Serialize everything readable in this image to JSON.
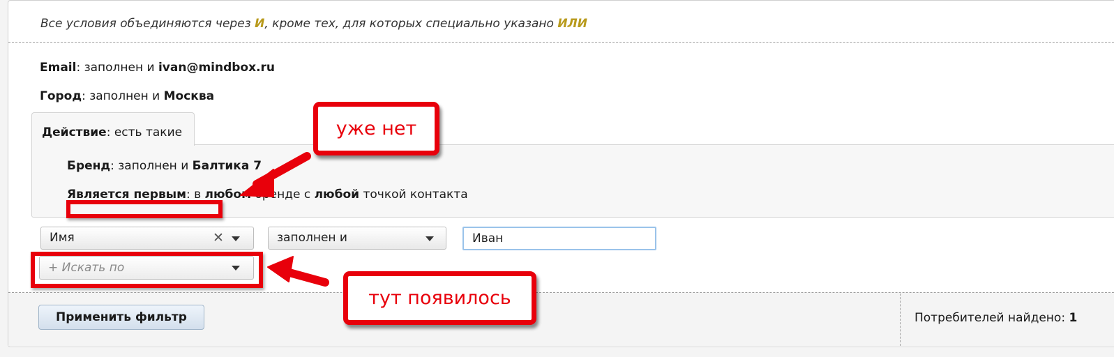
{
  "note": {
    "part1": "Все условия объединяются через ",
    "and_kw": "И",
    "part2": ", кроме тех, для которых специально указано ",
    "or_kw": "ИЛИ"
  },
  "conditions": [
    {
      "label": "Email",
      "text": ": заполнен и ",
      "value": "ivan@mindbox.ru"
    },
    {
      "label": "Город",
      "text": ": заполнен и ",
      "value": "Москва"
    }
  ],
  "action_tab": {
    "label": "Действие",
    "text": ": есть такие"
  },
  "action_conditions": {
    "brand": {
      "label": "Бренд",
      "text": ": заполнен и ",
      "value": "Балтика 7"
    },
    "first": {
      "label": "Является первым",
      "t1": ": в ",
      "b1": "любом",
      "t2": " бренде с ",
      "b2": "любой",
      "t3": " точкой контакта"
    }
  },
  "filter_row": {
    "field_select": "Имя",
    "clear_symbol": "✕",
    "operator_select": "заполнен и",
    "value_input": "Иван"
  },
  "search_by": {
    "label": "+ Искать по"
  },
  "footer": {
    "apply_button": "Применить фильтр",
    "found_label": "Потребителей найдено: ",
    "found_count": "1"
  },
  "annotations": {
    "callout_gone": "уже нет",
    "callout_appeared": "тут появилось",
    "color": "#e8000b"
  }
}
